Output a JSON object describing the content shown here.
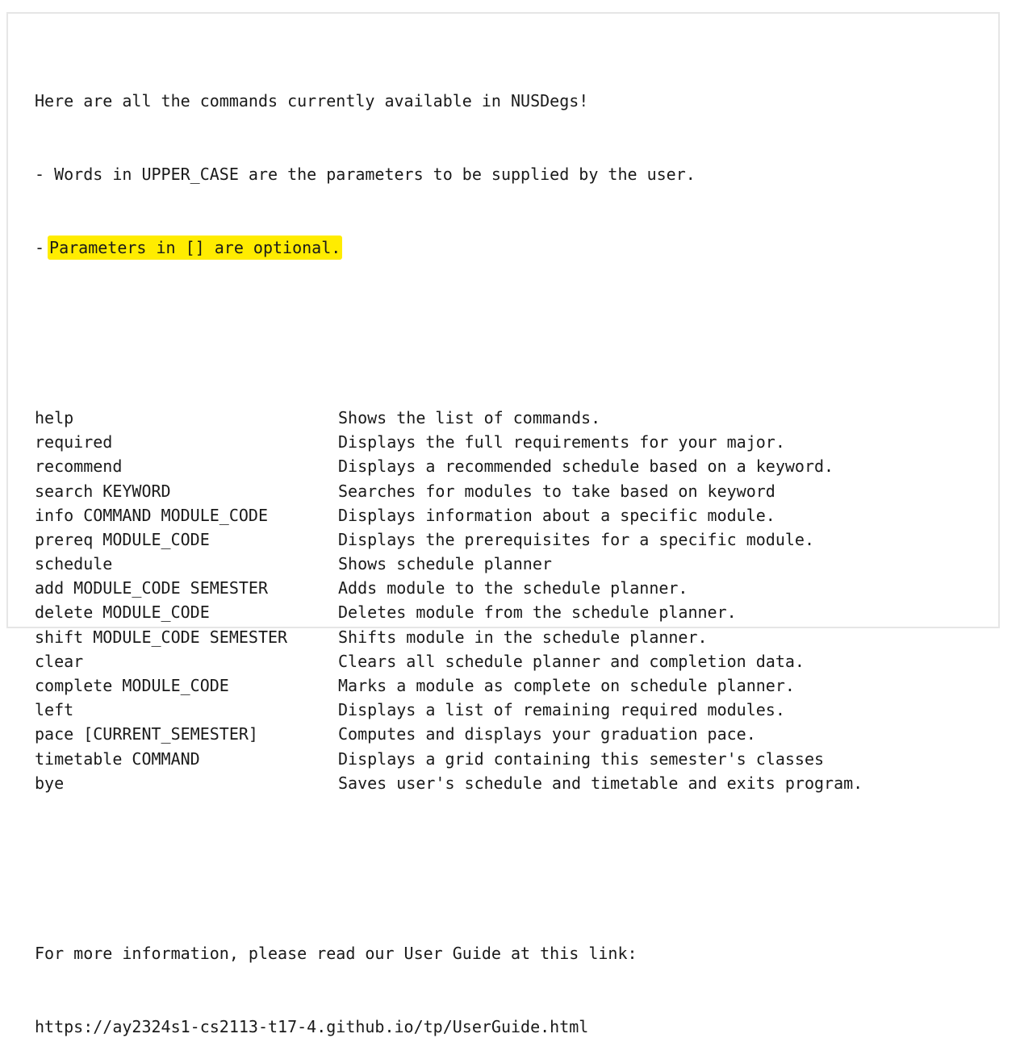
{
  "intro": {
    "line1": "Here are all the commands currently available in NUSDegs!",
    "line2": "- Words in UPPER_CASE are the parameters to be supplied by the user.",
    "line3_prefix": "-",
    "line3_highlight": "Parameters in [] are optional."
  },
  "highlight_color": "#ffec00",
  "commands": [
    {
      "cmd": "help",
      "desc": "Shows the list of commands."
    },
    {
      "cmd": "required",
      "desc": "Displays the full requirements for your major."
    },
    {
      "cmd": "recommend",
      "desc": "Displays a recommended schedule based on a keyword."
    },
    {
      "cmd": "search KEYWORD",
      "desc": "Searches for modules to take based on keyword"
    },
    {
      "cmd": "info COMMAND MODULE_CODE",
      "desc": "Displays information about a specific module."
    },
    {
      "cmd": "prereq MODULE_CODE",
      "desc": "Displays the prerequisites for a specific module."
    },
    {
      "cmd": "schedule",
      "desc": "Shows schedule planner"
    },
    {
      "cmd": "add MODULE_CODE SEMESTER",
      "desc": "Adds module to the schedule planner."
    },
    {
      "cmd": "delete MODULE_CODE",
      "desc": "Deletes module from the schedule planner."
    },
    {
      "cmd": "shift MODULE_CODE SEMESTER",
      "desc": "Shifts module in the schedule planner."
    },
    {
      "cmd": "clear",
      "desc": "Clears all schedule planner and completion data."
    },
    {
      "cmd": "complete MODULE_CODE",
      "desc": "Marks a module as complete on schedule planner."
    },
    {
      "cmd": "left",
      "desc": "Displays a list of remaining required modules."
    },
    {
      "cmd": "pace [CURRENT_SEMESTER]",
      "desc": "Computes and displays your graduation pace."
    },
    {
      "cmd": "timetable COMMAND",
      "desc": "Displays a grid containing this semester's classes"
    },
    {
      "cmd": "bye",
      "desc": "Saves user's schedule and timetable and exits program."
    }
  ],
  "footer": {
    "line1": "For more information, please read our User Guide at this link:",
    "link": "https://ay2324s1-cs2113-t17-4.github.io/tp/UserGuide.html"
  }
}
